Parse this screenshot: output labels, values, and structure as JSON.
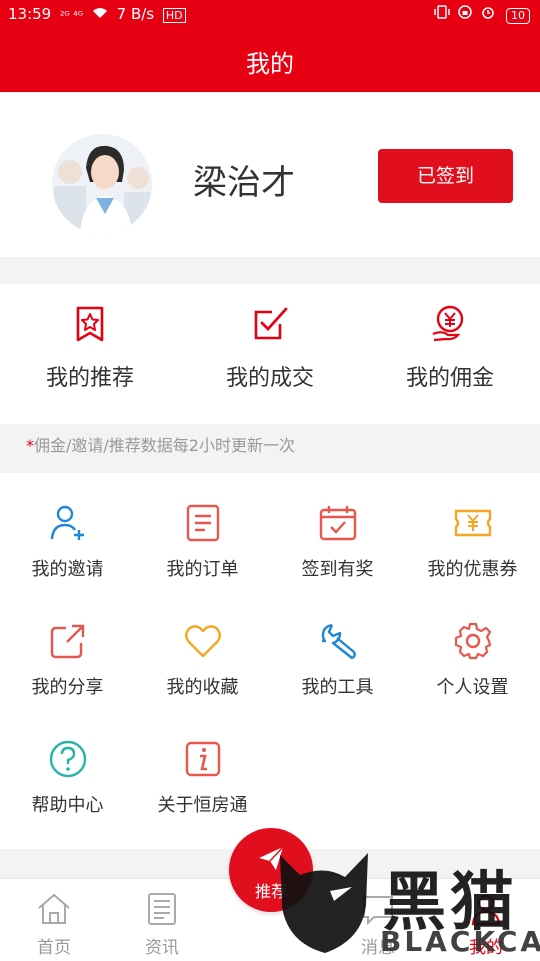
{
  "status_bar": {
    "time": "13:59",
    "signal": "²ᴳ ⁴ᴳ",
    "net_speed": "7 B/s",
    "hd": "HD",
    "battery": "10"
  },
  "header": {
    "title": "我的"
  },
  "profile": {
    "name": "梁治才",
    "checkin_label": "已签到"
  },
  "stats": [
    {
      "label": "我的推荐",
      "icon": "star-bookmark-icon"
    },
    {
      "label": "我的成交",
      "icon": "checkbox-pen-icon"
    },
    {
      "label": "我的佣金",
      "icon": "yen-coin-hand-icon"
    }
  ],
  "notice": {
    "star": "*",
    "text": "佣金/邀请/推荐数据每2小时更新一次"
  },
  "menu": [
    {
      "label": "我的邀请",
      "icon": "add-user-icon"
    },
    {
      "label": "我的订单",
      "icon": "document-icon"
    },
    {
      "label": "签到有奖",
      "icon": "calendar-check-icon"
    },
    {
      "label": "我的优惠券",
      "icon": "coupon-icon"
    },
    {
      "label": "我的分享",
      "icon": "share-icon"
    },
    {
      "label": "我的收藏",
      "icon": "heart-icon"
    },
    {
      "label": "我的工具",
      "icon": "wrench-icon"
    },
    {
      "label": "个人设置",
      "icon": "gear-icon"
    },
    {
      "label": "帮助中心",
      "icon": "help-icon"
    },
    {
      "label": "关于恒房通",
      "icon": "info-icon"
    }
  ],
  "tabs": [
    {
      "label": "首页",
      "icon": "home-icon"
    },
    {
      "label": "资讯",
      "icon": "news-icon"
    },
    {
      "label": "推荐",
      "icon": "send-icon"
    },
    {
      "label": "消息",
      "icon": "message-icon"
    },
    {
      "label": "我的",
      "icon": "user-icon"
    }
  ],
  "watermark": {
    "cn": "黑猫",
    "en": "BLACKCAT"
  },
  "colors": {
    "brand_red": "#e60012",
    "blue": "#1e88d6",
    "orange": "#f5a623",
    "teal": "#26b3a8"
  }
}
